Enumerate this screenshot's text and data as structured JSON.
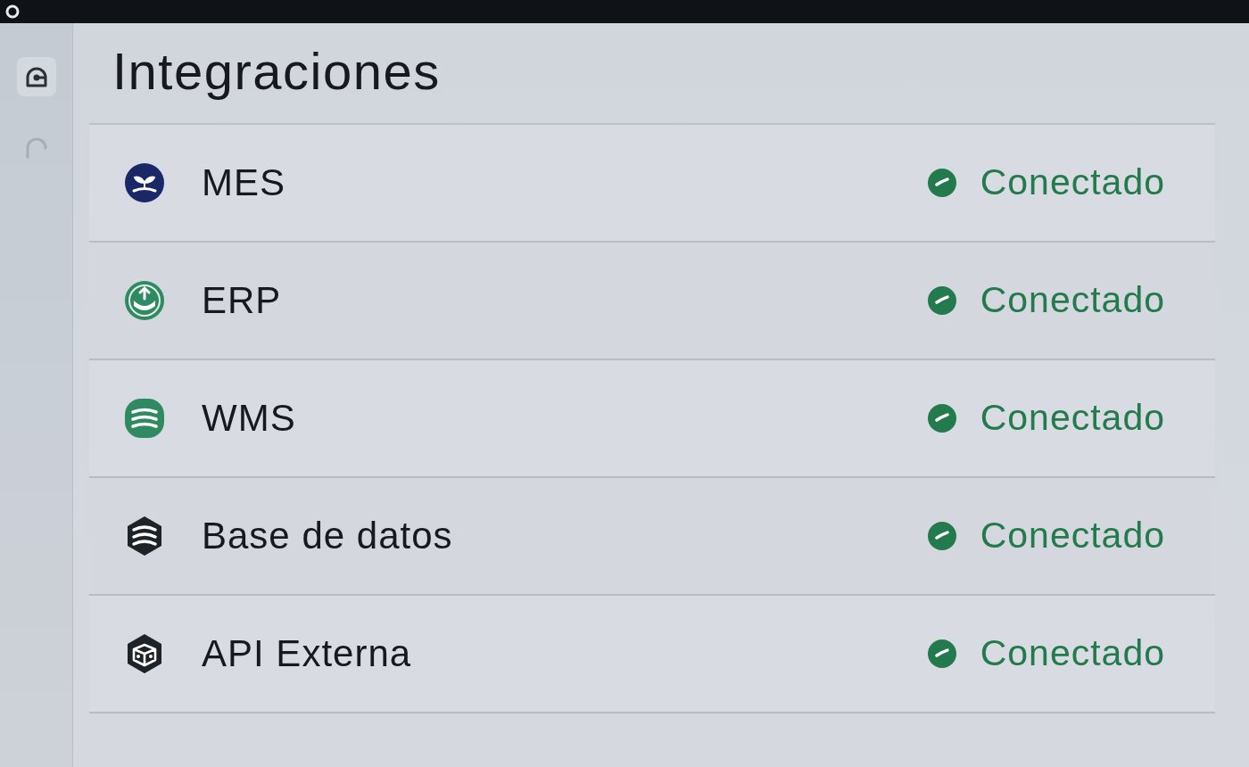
{
  "sidebar": {
    "items": [
      {
        "selected": true
      },
      {
        "selected": false
      }
    ]
  },
  "title": "Integraciones",
  "integrations": [
    {
      "name": "MES",
      "color": "#1b2868",
      "status": {
        "label": "Conectado",
        "connected": true
      }
    },
    {
      "name": "ERP",
      "color": "#2f8a62",
      "status": {
        "label": "Conectado",
        "connected": true
      }
    },
    {
      "name": "WMS",
      "color": "#2f8a62",
      "status": {
        "label": "Conectado",
        "connected": true
      }
    },
    {
      "name": "Base de datos",
      "color": "#1e2328",
      "status": {
        "label": "Conectado",
        "connected": true
      }
    },
    {
      "name": "API Externa",
      "color": "#1e2328",
      "status": {
        "label": "Conectado",
        "connected": true
      }
    }
  ]
}
